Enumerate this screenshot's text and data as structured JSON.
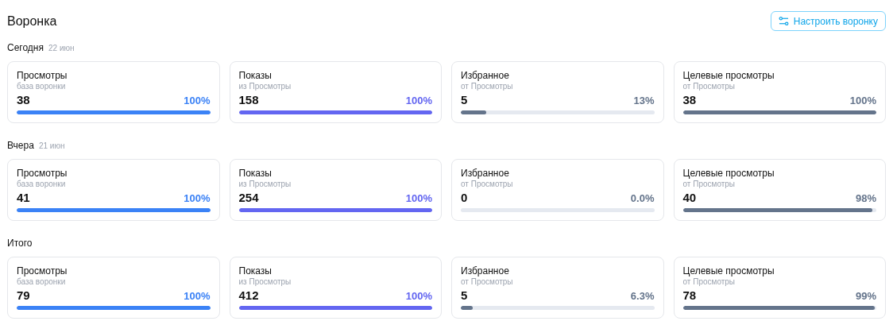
{
  "title": "Воронка",
  "configure_button": {
    "label": "Настроить воронку"
  },
  "sections": [
    {
      "label": "Сегодня",
      "date": "22 июн",
      "cards": [
        {
          "name": "Просмотры",
          "subtitle": "база воронки",
          "value": "38",
          "percent": "100%",
          "level": 1,
          "color": "#3b82f6"
        },
        {
          "name": "Показы",
          "subtitle": "из Просмотры",
          "value": "158",
          "percent": "100%",
          "level": 1,
          "color": "#6366f1"
        },
        {
          "name": "Избранное",
          "subtitle": "от Просмотры",
          "value": "5",
          "percent": "13%",
          "level": 0.13,
          "color": "#64748b"
        },
        {
          "name": "Целевые просмотры",
          "subtitle": "от Просмотры",
          "value": "38",
          "percent": "100%",
          "level": 1,
          "color": "#64748b"
        }
      ]
    },
    {
      "label": "Вчера",
      "date": "21 июн",
      "cards": [
        {
          "name": "Просмотры",
          "subtitle": "база воронки",
          "value": "41",
          "percent": "100%",
          "level": 1,
          "color": "#3b82f6"
        },
        {
          "name": "Показы",
          "subtitle": "из Просмотры",
          "value": "254",
          "percent": "100%",
          "level": 1,
          "color": "#6366f1"
        },
        {
          "name": "Избранное",
          "subtitle": "от Просмотры",
          "value": "0",
          "percent": "0.0%",
          "level": 0,
          "color": "#64748b"
        },
        {
          "name": "Целевые просмотры",
          "subtitle": "от Просмотры",
          "value": "40",
          "percent": "98%",
          "level": 0.98,
          "color": "#64748b"
        }
      ]
    },
    {
      "label": "Итого",
      "cards": [
        {
          "name": "Просмотры",
          "subtitle": "база воронки",
          "value": "79",
          "percent": "100%",
          "level": 1,
          "color": "#3b82f6"
        },
        {
          "name": "Показы",
          "subtitle": "из Просмотры",
          "value": "412",
          "percent": "100%",
          "level": 1,
          "color": "#6366f1"
        },
        {
          "name": "Избранное",
          "subtitle": "от Просмотры",
          "value": "5",
          "percent": "6.3%",
          "level": 0.063,
          "color": "#64748b"
        },
        {
          "name": "Целевые просмотры",
          "subtitle": "от Просмотры",
          "value": "78",
          "percent": "99%",
          "level": 0.99,
          "color": "#64748b"
        }
      ]
    }
  ]
}
